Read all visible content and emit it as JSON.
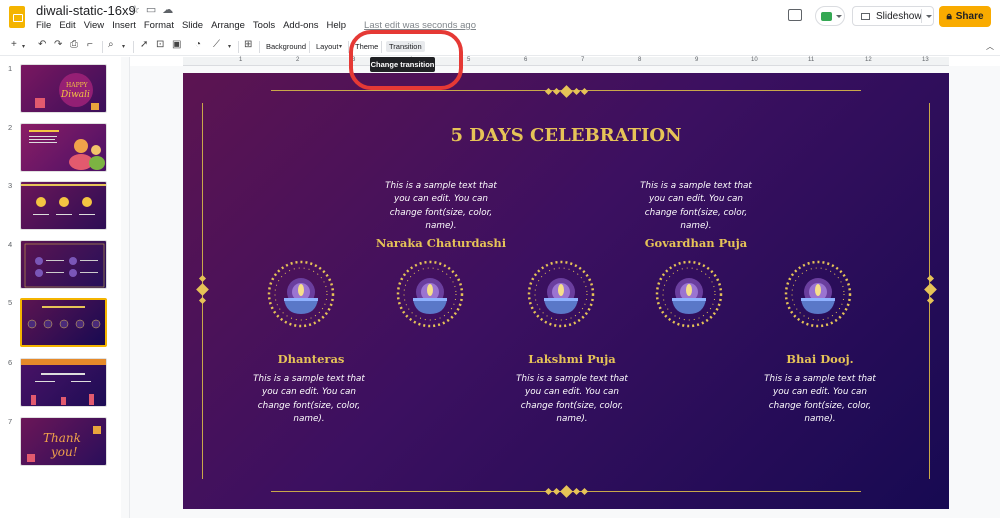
{
  "header": {
    "doc_title": "diwali-static-16x9",
    "menu": [
      "File",
      "Edit",
      "View",
      "Insert",
      "Format",
      "Slide",
      "Arrange",
      "Tools",
      "Add-ons",
      "Help"
    ],
    "last_edit": "Last edit was seconds ago",
    "slideshow_label": "Slideshow",
    "share_label": "Share"
  },
  "toolbar": {
    "background_label": "Background",
    "layout_label": "Layout",
    "theme_label": "Theme",
    "transition_label": "Transition",
    "tooltip": "Change transition"
  },
  "ruler": [
    "1",
    "2",
    "3",
    "4",
    "5",
    "6",
    "7",
    "8",
    "9",
    "10",
    "11",
    "12",
    "13"
  ],
  "filmstrip": {
    "numbers": [
      "1",
      "2",
      "3",
      "4",
      "5",
      "6",
      "7"
    ],
    "selected": "5"
  },
  "slide": {
    "title": "5 DAYS CELEBRATION",
    "sample_text": "This is a sample text that you can edit. You can change font(size, color, name).",
    "days": [
      "Dhanteras",
      "Naraka Chaturdashi",
      "Lakshmi Puja",
      "Govardhan Puja",
      "Bhai Dooj."
    ]
  },
  "colors": {
    "accent_gold": "#e6c357",
    "share_yellow": "#f9ab00",
    "highlight_red": "#e53935",
    "slide_purple": "#3c1060"
  }
}
